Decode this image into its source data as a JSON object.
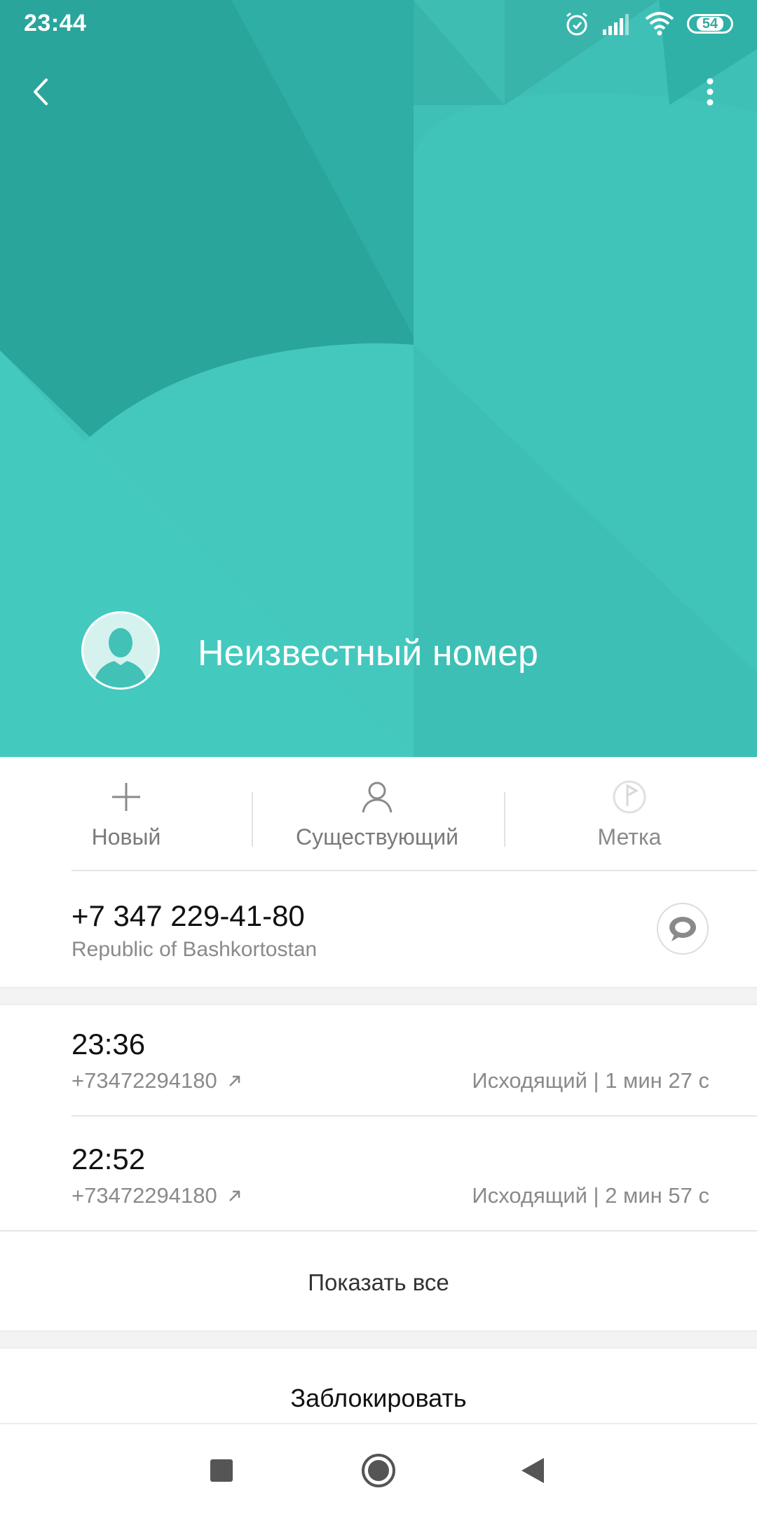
{
  "status_bar": {
    "time": "23:44",
    "battery": "54",
    "icons": [
      "alarm-icon",
      "signal-icon",
      "wifi-icon",
      "battery-icon"
    ]
  },
  "header": {
    "background_color": "#45c7bd",
    "contact_name": "Неизвестный номер",
    "icons": [
      "back-icon",
      "more-vert-icon",
      "avatar-icon"
    ]
  },
  "actions": [
    {
      "label": "Новый",
      "icon": "plus-icon"
    },
    {
      "label": "Существующий",
      "icon": "person-icon"
    },
    {
      "label": "Метка",
      "icon": "flag-icon"
    }
  ],
  "phone": {
    "number": "+7 347 229-41-80",
    "region": "Republic of Bashkortostan",
    "icon": "message-icon"
  },
  "calls": [
    {
      "time": "23:36",
      "number": "+73472294180",
      "detail": "Исходящий | 1 мин 27 с",
      "icon": "outgoing-arrow-icon"
    },
    {
      "time": "22:52",
      "number": "+73472294180",
      "detail": "Исходящий | 2 мин 57 с",
      "icon": "outgoing-arrow-icon"
    }
  ],
  "show_all_label": "Показать все",
  "block_label": "Заблокировать",
  "nav": [
    "recents-icon",
    "home-icon",
    "back-triangle-icon"
  ]
}
